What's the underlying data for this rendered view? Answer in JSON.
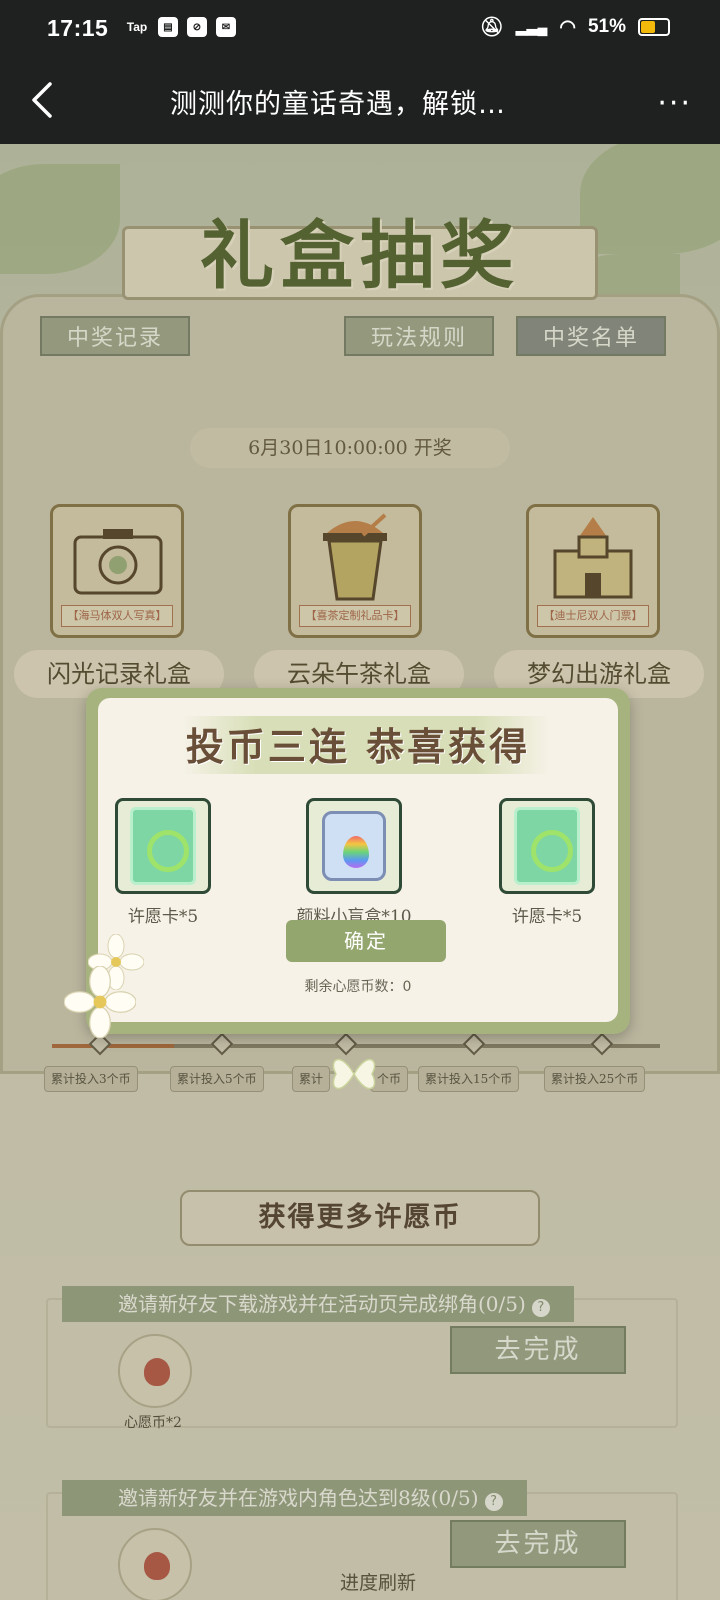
{
  "status_bar": {
    "time": "17:15",
    "app_icon_tap": "Tap",
    "battery": "51%"
  },
  "nav": {
    "title": "测测你的童话奇遇，解锁…",
    "more": "···"
  },
  "banner": {
    "title": "礼盒抽奖"
  },
  "tabs": {
    "records": "中奖记录",
    "rules": "玩法规则",
    "winners": "中奖名单"
  },
  "draw_date": "6月30日10:00:00 开奖",
  "prizes": [
    {
      "card_label": "【海马体双人写真】",
      "name": "闪光记录礼盒"
    },
    {
      "card_label": "【喜茶定制礼品卡】",
      "name": "云朵午茶礼盒"
    },
    {
      "card_label": "【迪士尼双人门票】",
      "name": "梦幻出游礼盒"
    }
  ],
  "progress": {
    "filled_fraction": 0.2,
    "steps": [
      "累计投入3个币",
      "累计投入5个币",
      "累计投入10个币",
      "累计投入15个币",
      "累计投入25个币"
    ],
    "visible_step_text": [
      "累计投入3个币",
      "累计投入5个币",
      "累计",
      "个币",
      "累计投入15个币",
      "累计投入25个币"
    ]
  },
  "section": {
    "title": "获得更多许愿币"
  },
  "tasks": [
    {
      "title": "邀请新好友下载游戏并在活动页完成绑角(0/5)",
      "reward_label": "心愿币*2",
      "button": "去完成"
    },
    {
      "title": "邀请新好友并在游戏内角色达到8级(0/5)",
      "reward_label": "",
      "button": "去完成"
    }
  ],
  "refresh_text": "进度刷新",
  "modal": {
    "title": "投币三连 恭喜获得",
    "rewards": [
      {
        "name": "许愿卡*5",
        "icon": "wish-card-icon"
      },
      {
        "name": "颜料小盲盒*10",
        "icon": "paint-bag-icon"
      },
      {
        "name": "许愿卡*5",
        "icon": "wish-card-icon"
      }
    ],
    "confirm": "确定",
    "remaining": "剩余心愿币数：0"
  },
  "colors": {
    "accent_green": "#93a66d",
    "card_border": "#2f4a36",
    "progress_fill": "#b0703f"
  }
}
